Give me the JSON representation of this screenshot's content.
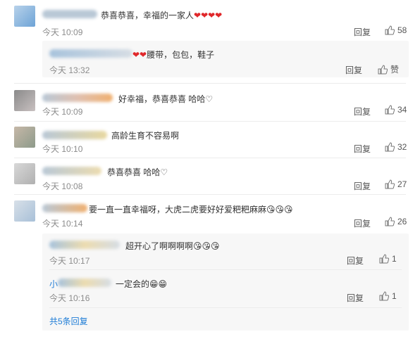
{
  "comments": [
    {
      "text": "恭喜恭喜，幸福的一家人",
      "hearts": "❤❤❤❤",
      "time": "今天 10:09",
      "reply": "回复",
      "likes": "58"
    },
    {
      "text": "腰带，包包，鞋子",
      "hearts": "❤❤",
      "time": "今天 13:32",
      "reply": "回复",
      "likes": "赞"
    },
    {
      "text": "好幸福，恭喜恭喜 哈哈♡",
      "time": "今天 10:09",
      "reply": "回复",
      "likes": "34"
    },
    {
      "text": "高龄生育不容易啊",
      "time": "今天 10:10",
      "reply": "回复",
      "likes": "32"
    },
    {
      "text": "恭喜恭喜 哈哈♡",
      "time": "今天 10:08",
      "reply": "回复",
      "likes": "27"
    },
    {
      "text": "要一直一直幸福呀，大虎二虎要好好爱粑粑麻麻",
      "emoji": "😘😘😘",
      "time": "今天 10:14",
      "reply": "回复",
      "likes": "26"
    }
  ],
  "subreplies": [
    {
      "text": "超开心了啊啊啊啊",
      "emoji": "😘😘😘",
      "time": "今天 10:17",
      "reply": "回复",
      "likes": "1"
    },
    {
      "prefix": "小",
      "text": "一定会的",
      "emoji": "😁😁",
      "time": "今天 10:16",
      "reply": "回复",
      "likes": "1"
    }
  ],
  "more_replies": "共5条回复",
  "colors": {
    "link": "#1e7cd6",
    "heart": "#e0272a",
    "muted": "#8c8c8c"
  }
}
